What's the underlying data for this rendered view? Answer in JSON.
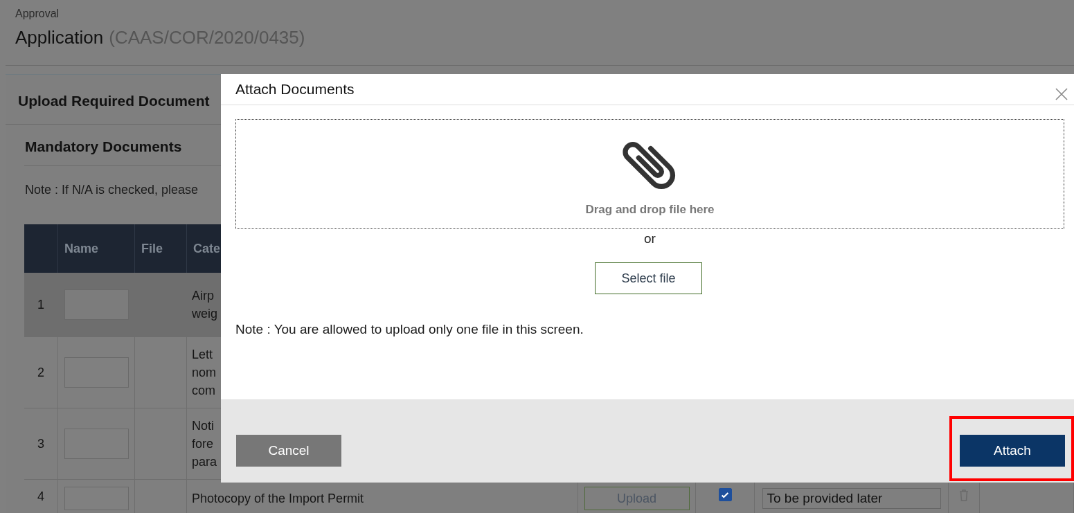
{
  "breadcrumb": "Approval",
  "page_title": {
    "text": "Application",
    "reference": "(CAAS/COR/2020/0435)"
  },
  "section_title": "Upload Required Document",
  "subsection_title": "Mandatory Documents",
  "note": "Note : If N/A is checked, please",
  "table": {
    "columns": [
      "Name",
      "File",
      "Cate"
    ],
    "rows": [
      {
        "index": "1",
        "highlighted": true,
        "category_lines": [
          "Airp",
          "weig"
        ]
      },
      {
        "index": "2",
        "highlighted": false,
        "category_lines": [
          "Lett",
          "nom",
          "com"
        ]
      },
      {
        "index": "3",
        "highlighted": false,
        "category_lines": [
          "Noti",
          "fore",
          "para"
        ]
      },
      {
        "index": "4",
        "highlighted": false,
        "category_lines": [
          "Photocopy of the Import Permit"
        ],
        "upload_label": "Upload",
        "na_checked": true,
        "remarks": "To be provided later"
      }
    ]
  },
  "dialog": {
    "title": "Attach Documents",
    "drop_text": "Drag and drop file here",
    "or_text": "or",
    "select_button": "Select file",
    "note": "Note : You are allowed to upload only one file in this screen.",
    "cancel_button": "Cancel",
    "attach_button": {
      "label": "Attach",
      "highlighted": true
    }
  }
}
